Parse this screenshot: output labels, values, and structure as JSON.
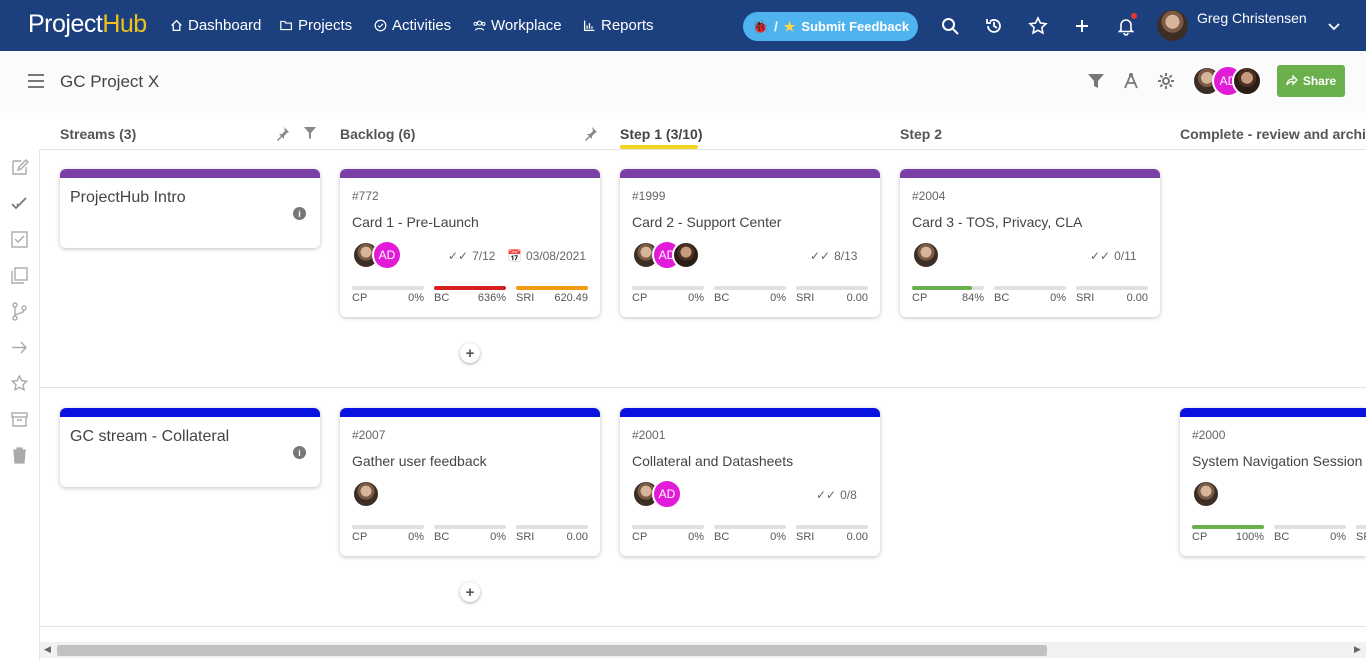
{
  "app": {
    "logo_text_a": "Project",
    "logo_text_b": "Hub",
    "user_name": "Greg Christensen"
  },
  "nav": [
    {
      "label": "Dashboard",
      "icon": "home-icon"
    },
    {
      "label": "Projects",
      "icon": "folder-open-icon"
    },
    {
      "label": "Activities",
      "icon": "check-circle-icon"
    },
    {
      "label": "Workplace",
      "icon": "users-icon"
    },
    {
      "label": "Reports",
      "icon": "bar-chart-icon"
    }
  ],
  "feedback": {
    "label": "Submit Feedback",
    "sep": "/"
  },
  "page": {
    "title": "GC Project X",
    "share_label": "Share"
  },
  "members": [
    {
      "kind": "photo"
    },
    {
      "kind": "initials",
      "text": "AD"
    },
    {
      "kind": "photo"
    }
  ],
  "columns": [
    {
      "label": "Streams (3)"
    },
    {
      "label": "Backlog (6)"
    },
    {
      "label": "Step 1 (3/10)"
    },
    {
      "label": "Step 2"
    },
    {
      "label": "Complete - review and archive"
    }
  ],
  "streams": [
    {
      "title": "ProjectHub Intro",
      "color": "#7b3fa8"
    },
    {
      "title": "GC stream - Collateral",
      "color": "#0a14e0"
    }
  ],
  "cards": [
    {
      "id": "#772",
      "title": "Card 1 - Pre-Launch",
      "checks": "7/12",
      "date": "03/08/2021",
      "metrics": [
        {
          "label": "CP",
          "value": "0%",
          "fill": 0,
          "color": "#6ab04c"
        },
        {
          "label": "BC",
          "value": "636%",
          "fill": 1,
          "color": "#d61f1f"
        },
        {
          "label": "SRI",
          "value": "620.49",
          "fill": 1,
          "color": "#f39c12"
        }
      ]
    },
    {
      "id": "#1999",
      "title": "Card 2 - Support Center",
      "checks": "8/13",
      "date": "",
      "metrics": [
        {
          "label": "CP",
          "value": "0%",
          "fill": 0,
          "color": "#6ab04c"
        },
        {
          "label": "BC",
          "value": "0%",
          "fill": 0,
          "color": "#6ab04c"
        },
        {
          "label": "SRI",
          "value": "0.00",
          "fill": 0,
          "color": "#6ab04c"
        }
      ]
    },
    {
      "id": "#2004",
      "title": "Card 3 - TOS, Privacy, CLA",
      "checks": "0/11",
      "date": "",
      "metrics": [
        {
          "label": "CP",
          "value": "84%",
          "fill": 0.84,
          "color": "#6ab04c"
        },
        {
          "label": "BC",
          "value": "0%",
          "fill": 0,
          "color": "#6ab04c"
        },
        {
          "label": "SRI",
          "value": "0.00",
          "fill": 0,
          "color": "#6ab04c"
        }
      ]
    },
    {
      "id": "#2007",
      "title": "Gather user feedback",
      "checks": "",
      "date": "",
      "metrics": [
        {
          "label": "CP",
          "value": "0%",
          "fill": 0,
          "color": "#6ab04c"
        },
        {
          "label": "BC",
          "value": "0%",
          "fill": 0,
          "color": "#6ab04c"
        },
        {
          "label": "SRI",
          "value": "0.00",
          "fill": 0,
          "color": "#6ab04c"
        }
      ]
    },
    {
      "id": "#2001",
      "title": "Collateral and Datasheets",
      "checks": "0/8",
      "date": "",
      "metrics": [
        {
          "label": "CP",
          "value": "0%",
          "fill": 0,
          "color": "#6ab04c"
        },
        {
          "label": "BC",
          "value": "0%",
          "fill": 0,
          "color": "#6ab04c"
        },
        {
          "label": "SRI",
          "value": "0.00",
          "fill": 0,
          "color": "#6ab04c"
        }
      ]
    },
    {
      "id": "#2000",
      "title": "System Navigation Session",
      "checks": "",
      "date": "",
      "metrics": [
        {
          "label": "CP",
          "value": "100%",
          "fill": 1,
          "color": "#6ab04c"
        },
        {
          "label": "BC",
          "value": "0%",
          "fill": 0,
          "color": "#6ab04c"
        },
        {
          "label": "SRI",
          "value": "",
          "fill": 0,
          "color": "#6ab04c"
        }
      ]
    }
  ],
  "ad_initials": "AD",
  "colors": {
    "topbar": "#1c3f7e",
    "purple": "#7b3fa8",
    "blue": "#0a14e0",
    "share": "#6ab04c",
    "feedback": "#4fb3f0",
    "step_underline": "#f5d41f"
  }
}
